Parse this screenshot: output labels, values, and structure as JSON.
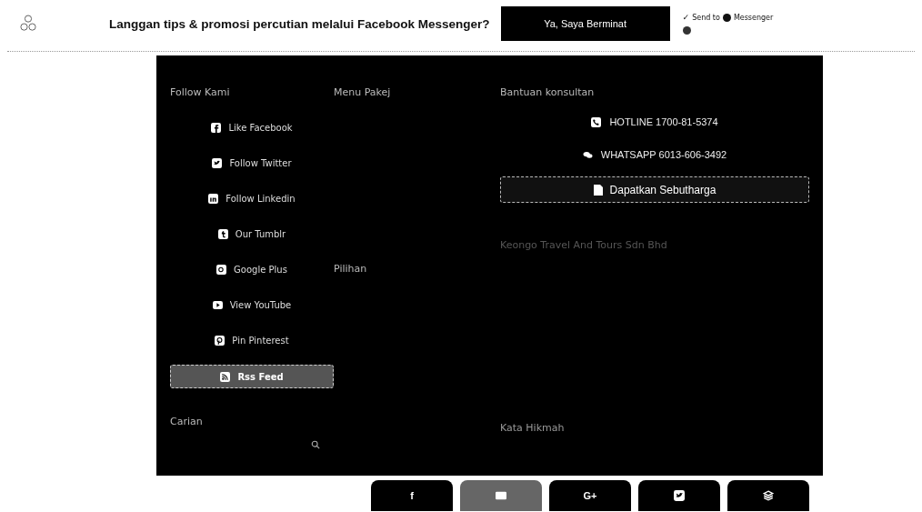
{
  "topbar": {
    "headline": "Langgan tips & promosi percutian melalui Facebook Messenger?",
    "button": "Ya, Saya Berminat",
    "check": "✓",
    "send_to": "Send to",
    "messenger": "Messenger"
  },
  "follow": {
    "title": "Follow Kami",
    "links": [
      {
        "label": "Like Facebook",
        "kind": "facebook",
        "selected": false
      },
      {
        "label": "Follow Twitter",
        "kind": "twitter",
        "selected": false
      },
      {
        "label": "Follow Linkedin",
        "kind": "linkedin",
        "selected": false
      },
      {
        "label": "Our Tumblr",
        "kind": "tumblr",
        "selected": false
      },
      {
        "label": "Google Plus",
        "kind": "gplus",
        "selected": false
      },
      {
        "label": "View YouTube",
        "kind": "youtube",
        "selected": false
      },
      {
        "label": "Pin Pinterest",
        "kind": "pinterest",
        "selected": false
      },
      {
        "label": "Rss Feed",
        "kind": "rss",
        "selected": true
      }
    ]
  },
  "search": {
    "title": "Carian"
  },
  "menu": {
    "title": "Menu Pakej",
    "subtitle": "Pilihan"
  },
  "help": {
    "title": "Bantuan konsultan",
    "contacts": [
      {
        "kind": "phone",
        "label": "HOTLINE 1700-81-5374"
      },
      {
        "kind": "chat",
        "label": "WHATSAPP 6013-606-3492"
      }
    ],
    "quote_button": "Dapatkan Sebutharga",
    "company": "Keongo Travel And Tours Sdn Bhd",
    "quote_title": "Kata Hikmah"
  },
  "share": [
    {
      "label": "f",
      "selected": false
    },
    {
      "kind": "email",
      "selected": true
    },
    {
      "label": "G+",
      "selected": false
    },
    {
      "kind": "twitter",
      "selected": false
    },
    {
      "kind": "buffer",
      "selected": false
    }
  ]
}
